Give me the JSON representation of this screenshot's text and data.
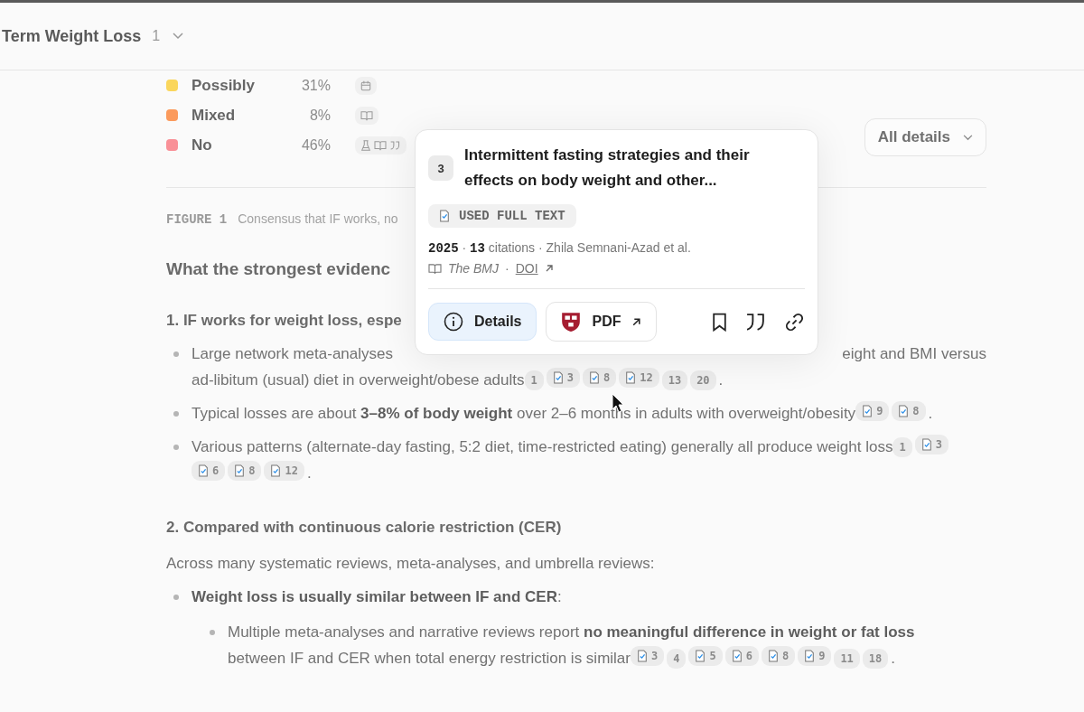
{
  "header": {
    "title": "Term Weight Loss",
    "count": "1"
  },
  "legend": [
    {
      "label": "Possibly",
      "percent": "31%",
      "color": "#fad65c",
      "icons": [
        {
          "kind": "calendar"
        }
      ]
    },
    {
      "label": "Mixed",
      "percent": "8%",
      "color": "#fb9a5c",
      "icons": [
        {
          "kind": "book"
        }
      ]
    },
    {
      "label": "No",
      "percent": "46%",
      "color": "#f99097",
      "icons": [
        {
          "kind": "flask"
        },
        {
          "kind": "book"
        },
        {
          "kind": "quote"
        }
      ]
    }
  ],
  "details_button": "All details",
  "figure": {
    "label": "FIGURE 1",
    "caption": "Consensus that IF works, no"
  },
  "heading": "What the strongest evidenc",
  "sections": [
    {
      "title": "1. IF works for weight loss, espe",
      "bullets": [
        {
          "kind": "covered",
          "before": "Large network meta-analyses",
          "after": "eight and BMI versus",
          "lines": [
            "ad-libitum (usual) diet in overweight/obese adults"
          ],
          "tail": ".",
          "citations": [
            {
              "number": "1",
              "full_text": false
            },
            {
              "number": "3",
              "full_text": true
            },
            {
              "number": "8",
              "full_text": true
            },
            {
              "number": "12",
              "full_text": true
            },
            {
              "number": "13",
              "full_text": false
            },
            {
              "number": "20",
              "full_text": false
            }
          ]
        },
        {
          "kind": "plain",
          "lines": [
            "Typical losses are about **3–8% of body weight** over 2–6 months in adults with overweight/obesity"
          ],
          "tail": ".",
          "citations": [
            {
              "number": "9",
              "full_text": true
            },
            {
              "number": "8",
              "full_text": true
            }
          ]
        },
        {
          "kind": "plain",
          "lines": [
            "Various patterns (alternate-day fasting, 5:2 diet, time-restricted eating) generally all produce weight loss"
          ],
          "tail": ".",
          "citations": [
            {
              "number": "1",
              "full_text": false
            },
            {
              "number": "3",
              "full_text": true
            },
            {
              "number": "6",
              "full_text": true
            },
            {
              "number": "8",
              "full_text": true
            },
            {
              "number": "12",
              "full_text": true
            }
          ]
        }
      ]
    },
    {
      "title": "2. Compared with continuous calorie restriction (CER)",
      "intro": "Across many systematic reviews, meta-analyses, and umbrella reviews:",
      "bullets": [
        {
          "kind": "plain",
          "lines": [
            "**Weight loss is usually similar between IF and CER**:"
          ],
          "children": [
            {
              "kind": "plain",
              "lines": [
                "Multiple meta-analyses and narrative reviews report **no meaningful difference in weight or fat loss**",
                "between IF and CER when total energy restriction is similar"
              ],
              "tail": ".",
              "citations": [
                {
                  "number": "3",
                  "full_text": true
                },
                {
                  "number": "4",
                  "full_text": false
                },
                {
                  "number": "5",
                  "full_text": true
                },
                {
                  "number": "6",
                  "full_text": true
                },
                {
                  "number": "8",
                  "full_text": true
                },
                {
                  "number": "9",
                  "full_text": true
                },
                {
                  "number": "11",
                  "full_text": false
                },
                {
                  "number": "18",
                  "full_text": false
                }
              ]
            }
          ]
        }
      ]
    }
  ],
  "popup": {
    "number": "3",
    "title": "Intermittent fasting strategies and their effects on body weight and other...",
    "badge": "USED FULL TEXT",
    "year": "2025",
    "separators": [
      "·",
      "·",
      "·"
    ],
    "citations": "13",
    "citations_label": "citations",
    "authors": "Zhila Semnani-Azad et al.",
    "journal": "The BMJ",
    "doi": "DOI",
    "buttons": [
      {
        "label": "Details",
        "kind": "details",
        "selected": true
      },
      {
        "label": "PDF",
        "kind": "pdf",
        "selected": false
      }
    ]
  }
}
